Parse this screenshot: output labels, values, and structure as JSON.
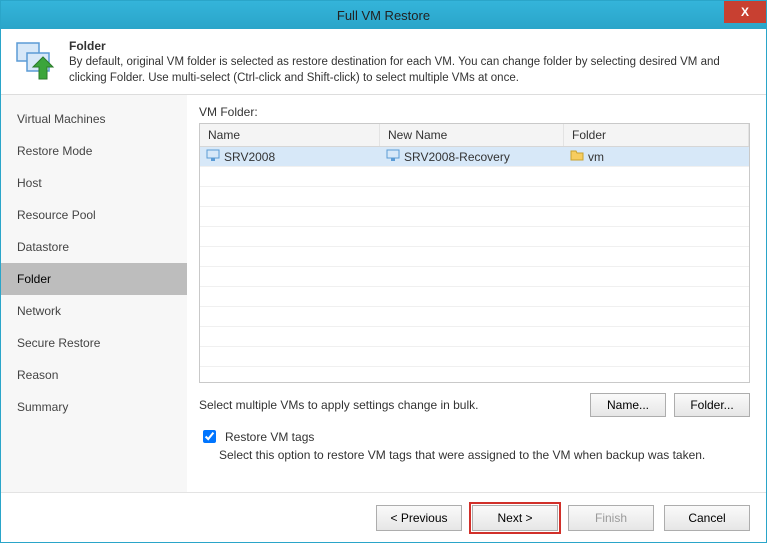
{
  "window": {
    "title": "Full VM Restore",
    "close": "X"
  },
  "header": {
    "title": "Folder",
    "description": "By default, original VM folder is selected as restore destination for each VM. You can change folder by selecting desired VM and clicking Folder. Use multi-select (Ctrl-click and Shift-click) to select multiple VMs at once."
  },
  "sidebar": {
    "steps": [
      "Virtual Machines",
      "Restore Mode",
      "Host",
      "Resource Pool",
      "Datastore",
      "Folder",
      "Network",
      "Secure Restore",
      "Reason",
      "Summary"
    ],
    "activeIndex": 5
  },
  "main": {
    "vmFolderLabel": "VM Folder:",
    "columns": {
      "name": "Name",
      "newName": "New Name",
      "folder": "Folder"
    },
    "rows": [
      {
        "name": "SRV2008",
        "newName": "SRV2008-Recovery",
        "folder": "vm"
      }
    ],
    "bulkHint": "Select multiple VMs to apply settings change in bulk.",
    "nameBtn": "Name...",
    "folderBtn": "Folder...",
    "restoreTagsLabel": "Restore VM tags",
    "restoreTagsChecked": true,
    "restoreTagsDesc": "Select this option to restore VM tags that were assigned to the VM when backup was taken."
  },
  "footer": {
    "previous": "< Previous",
    "next": "Next >",
    "finish": "Finish",
    "cancel": "Cancel"
  }
}
